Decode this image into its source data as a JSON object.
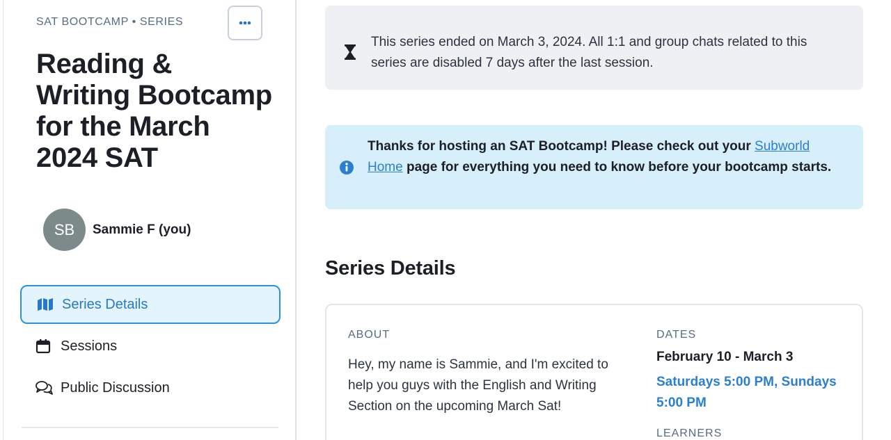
{
  "sidebar": {
    "eyebrow": "SAT BOOTCAMP • SERIES",
    "more_icon": "more-horizontal-icon",
    "title": "Reading & Writing Bootcamp for the March 2024 SAT",
    "host": {
      "initials": "SB",
      "name": "Sammie F (you)"
    },
    "nav": [
      {
        "label": "Series Details",
        "icon": "map-icon",
        "active": true
      },
      {
        "label": "Sessions",
        "icon": "calendar-icon",
        "active": false
      },
      {
        "label": "Public Discussion",
        "icon": "chat-bubbles-icon",
        "active": false
      }
    ]
  },
  "banners": {
    "ended": {
      "icon": "hourglass-icon",
      "text": "This series ended on March 3, 2024. All 1:1 and group chats related to this series are disabled 7 days after the last session."
    },
    "info": {
      "icon": "info-icon",
      "text_before": "Thanks for hosting an SAT Bootcamp! Please check out your ",
      "link_text": "Subworld Home",
      "text_after": " page for everything you need to know before your bootcamp starts."
    }
  },
  "details": {
    "section_title": "Series Details",
    "about_label": "ABOUT",
    "about_text": "Hey, my name is Sammie, and I'm excited to help you guys with the English and Writing Section on the upcoming March Sat!",
    "dates_label": "DATES",
    "date_range": "February 10 - March 3",
    "schedule": "Saturdays 5:00 PM, Sundays 5:00 PM",
    "learners_label": "LEARNERS"
  },
  "colors": {
    "accent": "#2b7fd2",
    "active_nav_bg": "#e3f4fc",
    "info_banner_bg": "#d6effb",
    "ended_banner_bg": "#eef0f3",
    "avatar_bg": "#7c8a8a"
  }
}
